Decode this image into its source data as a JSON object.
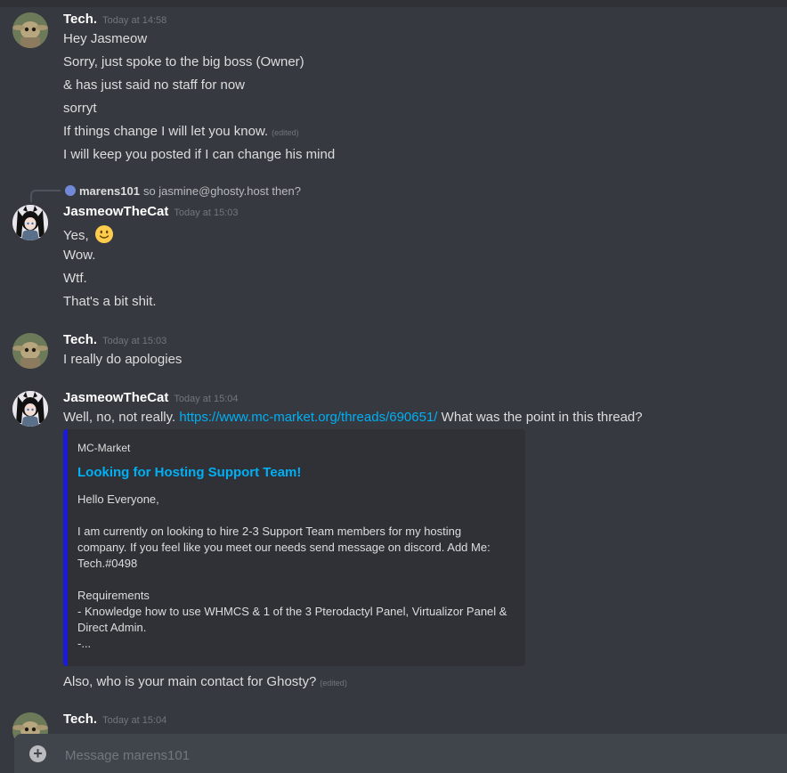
{
  "messages": [
    {
      "author": "Tech.",
      "timestamp": "Today at 14:58",
      "avatar_icon": "baby-yoda-avatar-icon",
      "lines": [
        "Hey Jasmeow",
        "Sorry, just spoke to the big boss (Owner)",
        "& has just said no staff for now",
        "sorryt",
        "If things change I will let you know.",
        "I will keep you posted if I can change his mind"
      ]
    },
    {
      "reply": {
        "author": "marens101",
        "text": "so jasmine@ghosty.host then?"
      },
      "author": "JasmeowTheCat",
      "timestamp": "Today at 15:03",
      "avatar_icon": "anime-cat-girl-avatar-icon",
      "lines": [
        "Yes,",
        "Wow.",
        "Wtf.",
        "That's a bit shit."
      ],
      "emoji": "slightly-smiling-face-emoji"
    },
    {
      "author": "Tech.",
      "timestamp": "Today at 15:03",
      "avatar_icon": "baby-yoda-avatar-icon",
      "lines": [
        "I really do apologies"
      ]
    },
    {
      "author": "JasmeowTheCat",
      "timestamp": "Today at 15:04",
      "avatar_icon": "anime-cat-girl-avatar-icon",
      "line_prefix": "Well, no, not really.",
      "link": "https://www.mc-market.org/threads/690651/",
      "line_suffix": "What was the point in this thread?",
      "embed": {
        "provider": "MC-Market",
        "title": "Looking for Hosting Support Team!",
        "description": "Hello Everyone,\n\nI am currently on looking to hire 2-3 Support Team members for my hosting company. If you feel like you meet our needs send message on discord. Add Me: Tech.#0498\n\nRequirements\n- Knowledge how to use WHMCS & 1 of the 3 Pterodactyl Panel, Virtualizor Panel & Direct Admin.\n-...",
        "accent_color": "#1a1bd8"
      },
      "after_line": "Also, who is your main contact for Ghosty?"
    },
    {
      "author": "Tech.",
      "timestamp": "Today at 15:04",
      "avatar_icon": "baby-yoda-avatar-icon"
    }
  ],
  "edited_label": "(edited)",
  "composer": {
    "placeholder": "Message marens101",
    "plus_icon": "add-attachment-icon",
    "plus_glyph": "+"
  },
  "colors": {
    "background": "#36393f",
    "link": "#00aff4",
    "username": "#ffffff",
    "text": "#dcddde",
    "muted": "#72767d"
  }
}
